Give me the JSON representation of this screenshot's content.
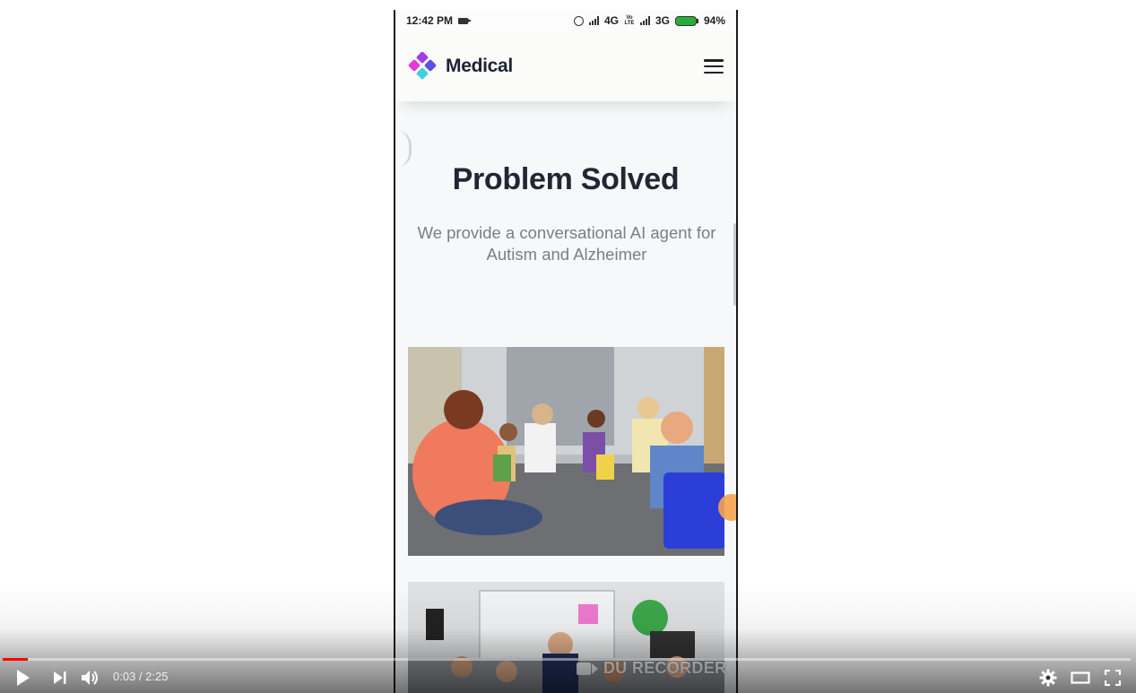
{
  "status_bar": {
    "time": "12:42 PM",
    "network_1": "4G",
    "network_2": "3G",
    "battery": "94%",
    "volte": "Vo LTE"
  },
  "app": {
    "brand": "Medical",
    "logo_colors": [
      "#a23ce6",
      "#e43ad8",
      "#5a4fe8",
      "#3fd0e0"
    ]
  },
  "section": {
    "title": "Problem Solved",
    "description": "We provide a conversational AI agent for Autism and Alzheimer"
  },
  "watermark": "DU RECORDER",
  "player": {
    "current_time": "0:03",
    "duration": "2:25",
    "separator": " / ",
    "progress_fraction": 0.022,
    "accent_color": "#ff0000"
  }
}
